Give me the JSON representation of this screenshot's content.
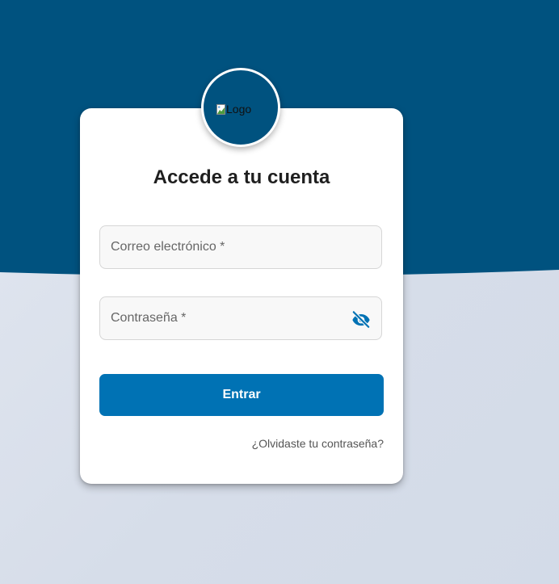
{
  "colors": {
    "header_band": "#00527f",
    "background": "#dbe2ed",
    "card": "#ffffff",
    "primary_button": "#0072b4",
    "eye_icon": "#0072b4"
  },
  "logo": {
    "alt": "Logo",
    "icon": "broken-image-icon"
  },
  "login": {
    "title": "Accede a tu cuenta",
    "email_placeholder": "Correo electrónico *",
    "password_placeholder": "Contraseña *",
    "password_toggle_icon": "eye-off-icon",
    "submit_label": "Entrar",
    "forgot_label": "¿Olvidaste tu contraseña?"
  }
}
